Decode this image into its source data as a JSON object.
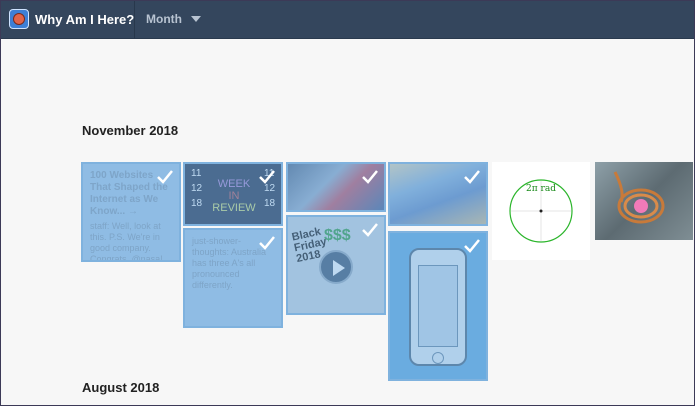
{
  "app": {
    "title": "Why Am I Here?",
    "logo_icon": "app-logo-icon"
  },
  "toolbar": {
    "view_mode": "Month",
    "view_caret_icon": "caret-down-icon"
  },
  "sections": [
    {
      "heading": "November 2018"
    },
    {
      "heading": "August 2018"
    }
  ],
  "tiles": {
    "websites": {
      "title": "100 Websites That Shaped the Internet as We Know... →",
      "body": "staff: Well, look at this. P.S. We're in good company. Congrats, @nasa!"
    },
    "shower": {
      "body": "just-shower-thoughts: Australia has three A's all pronounced differently."
    },
    "week": {
      "line1": "WEEK",
      "line2": "IN",
      "line3": "REVIEW",
      "nums": [
        "11",
        "12",
        "18",
        "11",
        "12",
        "18"
      ]
    },
    "blackfriday": {
      "line1": "Black",
      "line2": "Friday",
      "line3": "2018",
      "dollars": "$$$"
    },
    "circle": {
      "label": "2π rad"
    }
  },
  "colors": {
    "topbar": "#34465d",
    "selection": "#7fb2de",
    "accent": "#66aee0"
  }
}
